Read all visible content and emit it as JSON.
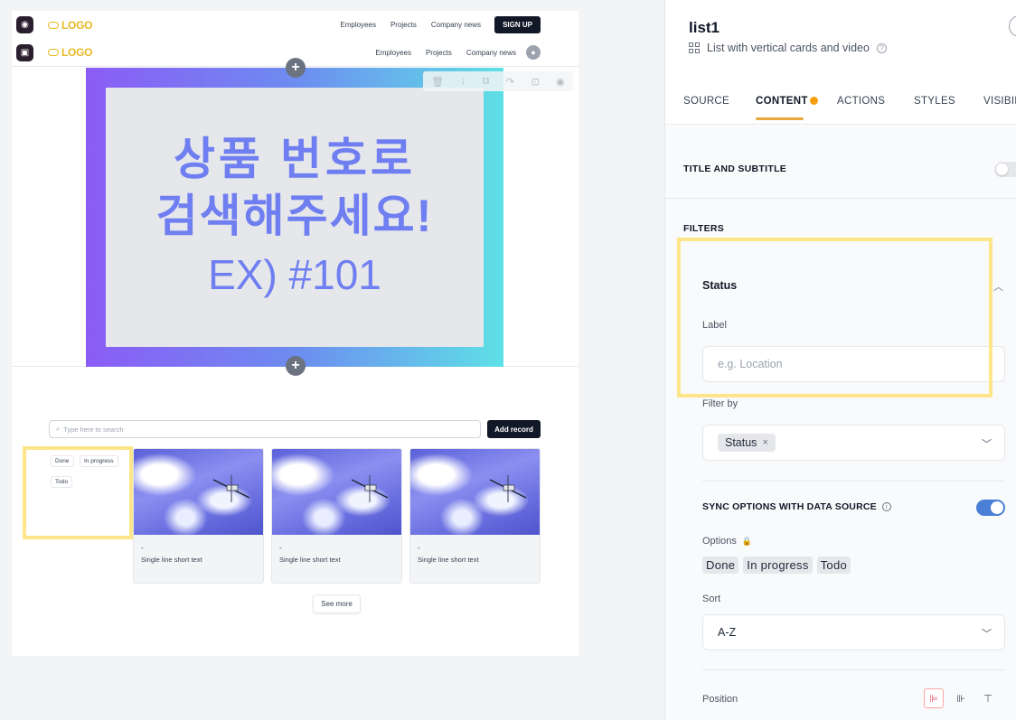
{
  "canvas": {
    "nav": {
      "logo_text": "LOGO",
      "links": [
        "Employees",
        "Projects",
        "Company news"
      ],
      "signup_label": "SIGN UP"
    },
    "banner": {
      "line1": "상품 번호로",
      "line2": "검색해주세요!",
      "line3": "EX) #101"
    },
    "search": {
      "placeholder": "Type here to search",
      "add_record_label": "Add record"
    },
    "filter_chips": [
      "Done",
      "In progress",
      "Todo"
    ],
    "cards": [
      {
        "title": "-",
        "text": "Single line short text"
      },
      {
        "title": "-",
        "text": "Single line short text"
      },
      {
        "title": "-",
        "text": "Single line short text"
      }
    ],
    "see_more_label": "See more"
  },
  "panel": {
    "title": "list1",
    "subtitle": "List with vertical cards and video",
    "tabs": [
      "SOURCE",
      "CONTENT",
      "ACTIONS",
      "STYLES",
      "VISIBIL"
    ],
    "active_tab": "CONTENT",
    "title_and_subtitle_label": "TITLE AND SUBTITLE",
    "title_and_subtitle_enabled": false,
    "filters_label": "FILTERS",
    "filter": {
      "name": "Status",
      "label_field_label": "Label",
      "label_placeholder": "e.g. Location",
      "filter_by_label": "Filter by",
      "filter_by_value": "Status",
      "sync_label": "SYNC OPTIONS WITH DATA SOURCE",
      "sync_enabled": true,
      "options_label": "Options",
      "options": [
        "Done",
        "In progress",
        "Todo"
      ],
      "sort_label": "Sort",
      "sort_value": "A-Z",
      "position_label": "Position"
    }
  },
  "colors": {
    "accent_orange": "#f59e0b",
    "toggle_blue": "#4a7fd6",
    "highlight_yellow": "#fde68a",
    "logo_gold": "#e8b923"
  }
}
